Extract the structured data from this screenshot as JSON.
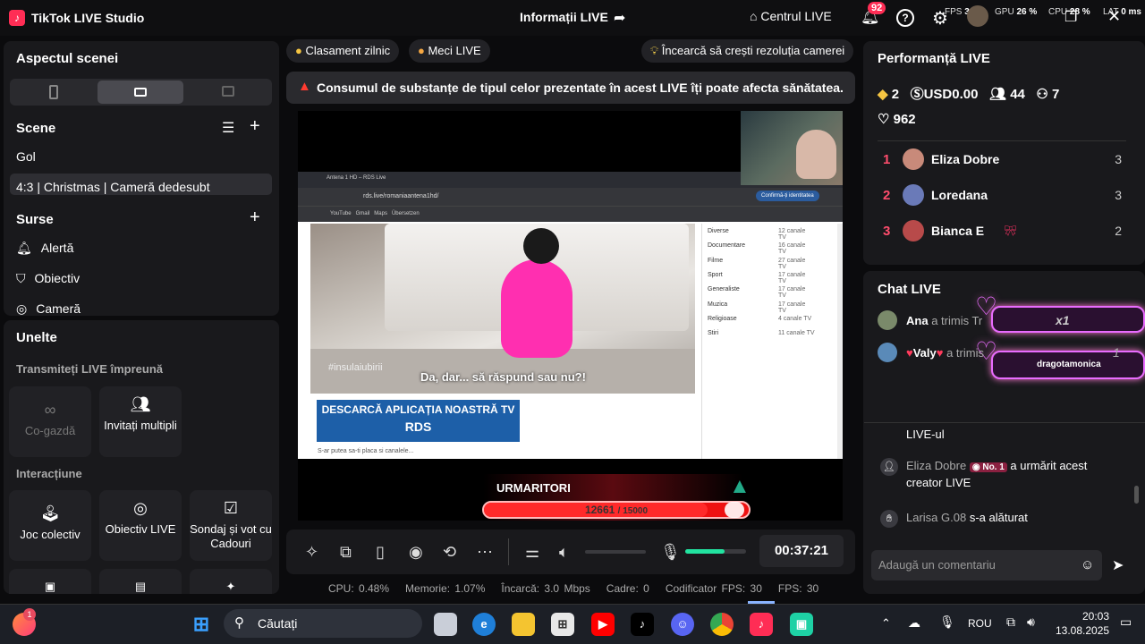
{
  "titlebar": {
    "app": "TikTok LIVE Studio",
    "live_info": "Informații LIVE",
    "center": "Centrul LIVE",
    "notifications": "92",
    "stats": [
      {
        "k": "FPS",
        "v": "30"
      },
      {
        "k": "GPU",
        "v": "26 %"
      },
      {
        "k": "CPU",
        "v": "28 %"
      },
      {
        "k": "LAT",
        "v": "0 ms"
      }
    ]
  },
  "left": {
    "scene_layout_title": "Aspectul scenei",
    "scenes_title": "Scene",
    "scenes": [
      "Gol",
      "4:3 | Christmas | Cameră dedesubt"
    ],
    "sources_title": "Surse",
    "sources": [
      "Alertă",
      "Obiectiv",
      "Cameră"
    ],
    "tools_title": "Unelte",
    "collab_title": "Transmiteți LIVE împreună",
    "cohost": "Co-gazdă",
    "invite_multi": "Invitați multipli",
    "interaction_title": "Interacțiune",
    "interactions": [
      "Joc colectiv",
      "Obiectiv LIVE",
      "Sondaj și vot cu Cadouri"
    ]
  },
  "center": {
    "pill1": "Clasament zilnic",
    "pill2": "Meci LIVE",
    "tip": "Încearcă să crești rezoluția camerei",
    "warning": "Consumul de substanțe de tipul celor prezentate în acest LIVE îți poate afecta sănătatea.",
    "browser": {
      "tab": "Antena 1 HD – RDS Live",
      "url": "rds.live/romaniaantena1hd/",
      "confirm": "Confirmă-ți identitatea",
      "bm1": "YouTube",
      "bm2": "Gmail",
      "bm3": "Maps",
      "bm4": "Übersetzen"
    },
    "subtitle": "Da, dar... să răspund sau nu?!",
    "watermark": "#insulaiubirii",
    "channels": [
      [
        "Diverse",
        "12 canale TV"
      ],
      [
        "Documentare",
        "16 canale TV"
      ],
      [
        "Filme",
        "27 canale TV"
      ],
      [
        "Sport",
        "17 canale TV"
      ],
      [
        "Generaliste",
        "17 canale TV"
      ],
      [
        "Muzica",
        "17 canale TV"
      ],
      [
        "Religioase",
        "4 canale TV"
      ],
      [
        "Stiri",
        "11 canale TV"
      ]
    ],
    "rds_banner": "DESCARCĂ APLICAȚIA NOASTRĂ TV",
    "rds_logo": "RDS",
    "browser_foot": "S-ar putea sa-ti placa si canalele...",
    "followers_label": "URMARITORI",
    "followers_current": "12661",
    "followers_goal": "/ 15000",
    "followers_progress": 0.844,
    "timer": "00:37:21",
    "mic_level": 0.65,
    "perf": {
      "cpu": "CPU:  0.48%",
      "mem": "Memorie:  1.07%",
      "upload": "Încarcă:  3.0 Mbps",
      "frames": "Cadre:  0",
      "encoder": "Codificator FPS:  30",
      "fps": "FPS:  30"
    }
  },
  "right": {
    "perf_title": "Performanță LIVE",
    "diamonds": "2",
    "usd": "USD0.00",
    "viewers": "44",
    "newfollowers": "7",
    "likes": "962",
    "ranking": [
      {
        "n": "1",
        "name": "Eliza Dobre",
        "s": "3"
      },
      {
        "n": "2",
        "name": "Loredana",
        "s": "3"
      },
      {
        "n": "3",
        "name": "Bianca E",
        "s": "2"
      }
    ],
    "chat_title": "Chat LIVE",
    "gift1_user": "Ana",
    "gift1_text": "a trimis Tr",
    "gift1_x": "x1",
    "gift2_user": "Valy",
    "gift2_text": "a trimis",
    "gift2_x": "1",
    "gift_overlay_name": "dragotamonica",
    "chat_live": "LIVE-ul",
    "chat_user1": "Eliza Dobre",
    "chat_badge": "No. 1",
    "chat_msg1": "a urmărit acest creator LIVE",
    "chat_user2": "Larisa G.08",
    "chat_msg2": "s-a alăturat",
    "comment_placeholder": "Adaugă un comentariu"
  },
  "taskbar": {
    "search": "Căutați",
    "lang": "ROU",
    "time": "20:03",
    "date": "13.08.2025",
    "badge": "1"
  },
  "colors": {
    "accent": "#ff2d55",
    "mic_green": "#22e3a0"
  }
}
